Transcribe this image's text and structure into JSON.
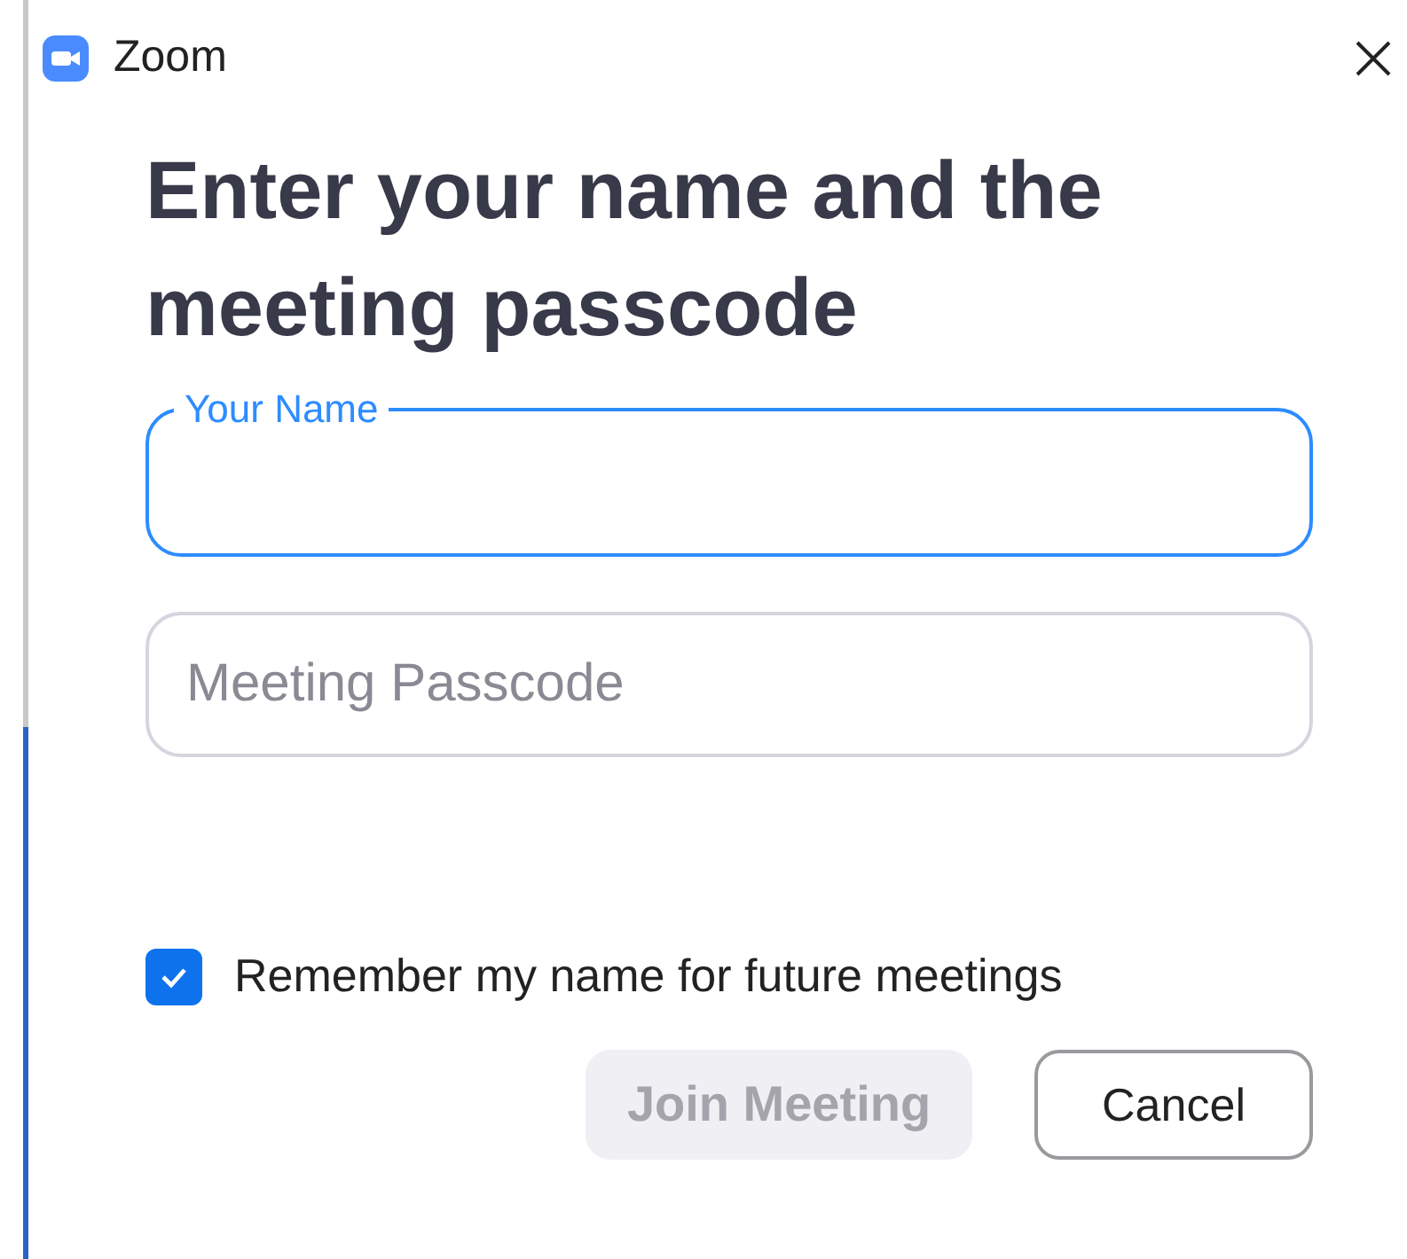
{
  "window": {
    "title": "Zoom"
  },
  "heading": "Enter your name and the meeting passcode",
  "fields": [
    {
      "label": "Your Name",
      "focused": true
    },
    {
      "placeholder": "Meeting Passcode",
      "focused": false
    }
  ],
  "remember": {
    "label": "Remember my name for future meetings",
    "checked": true
  },
  "buttons": [
    {
      "label": "Join Meeting",
      "kind": "primary",
      "disabled": true
    },
    {
      "label": "Cancel",
      "kind": "secondary",
      "disabled": false
    }
  ]
}
